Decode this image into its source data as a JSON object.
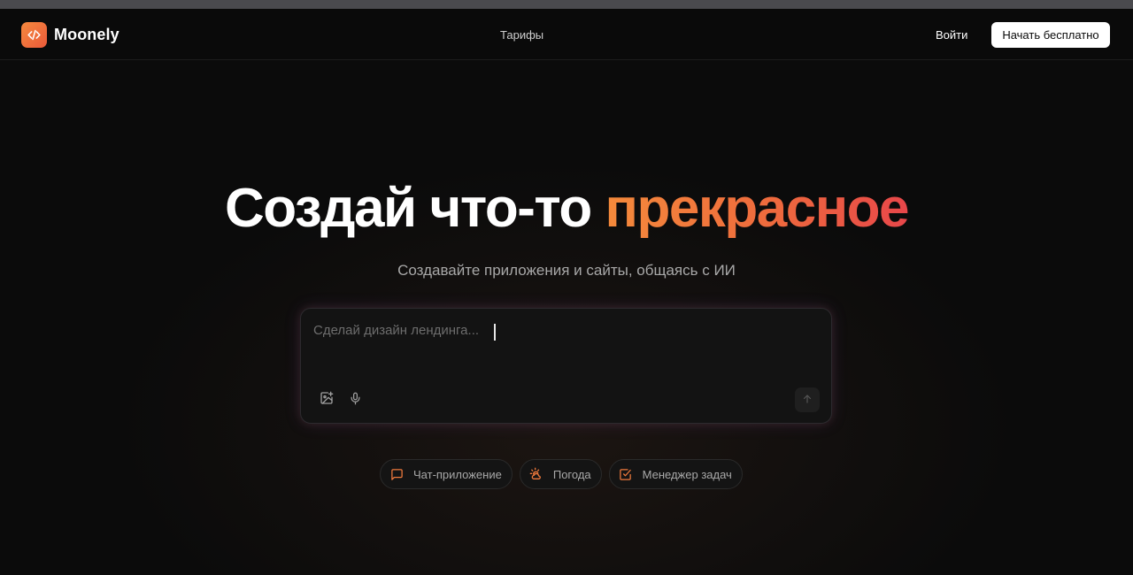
{
  "brand": {
    "name": "Moonely",
    "logo_icon": "code-brackets-icon",
    "accent": "#f07a3c"
  },
  "nav": {
    "pricing": "Тарифы",
    "login": "Войти",
    "cta": "Начать бесплатно"
  },
  "hero": {
    "title_main": "Создай что-то ",
    "title_accent": "прекрасное",
    "subtitle": "Создавайте приложения и сайты, общаясь с ИИ"
  },
  "prompt": {
    "placeholder": "Сделай дизайн лендинга...",
    "tools": [
      "image-upload-icon",
      "microphone-icon"
    ],
    "send_icon": "arrow-up-icon"
  },
  "suggestions": [
    {
      "label": "Чат-приложение",
      "icon": "chat-bubble-icon"
    },
    {
      "label": "Погода",
      "icon": "sun-cloud-icon"
    },
    {
      "label": "Менеджер задач",
      "icon": "checkbox-icon"
    }
  ]
}
